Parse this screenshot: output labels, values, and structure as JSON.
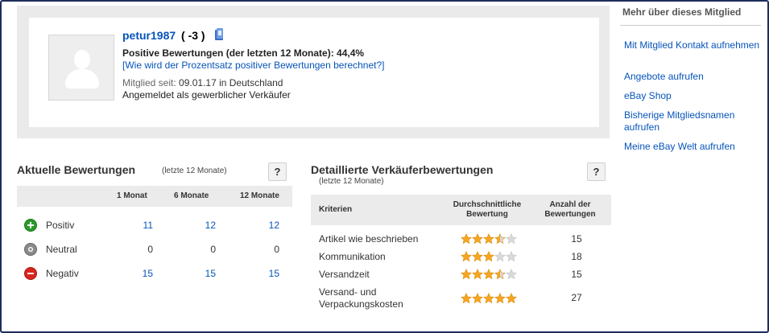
{
  "profile": {
    "username": "petur1987",
    "score": "( -3 )",
    "positive_line": "Positive Bewertungen (der letzten 12 Monate): 44,4%",
    "positive_link": "[Wie wird der Prozentsatz positiver Bewertungen berechnet?]",
    "member_since_label": "Mitglied seit:",
    "member_since_value": "09.01.17 in Deutschland",
    "seller_type": "Angemeldet als gewerblicher Verkäufer",
    "badge_icon": "blue-badge-icon"
  },
  "sidebar": {
    "title": "Mehr über dieses Mitglied",
    "links": [
      "Mit Mitglied Kontakt aufnehmen",
      "Angebote aufrufen",
      "eBay Shop",
      "Bisherige Mitgliedsnamen aufrufen",
      "Meine eBay Welt aufrufen"
    ]
  },
  "feedback": {
    "title": "Aktuelle Bewertungen",
    "subtitle": "(letzte 12 Monate)",
    "help": "?",
    "columns": [
      "1 Monat",
      "6 Monate",
      "12 Monate"
    ],
    "rows": [
      {
        "label": "Positiv",
        "icon": "plus-circle-icon",
        "color": "#2a9a2a",
        "values": [
          "11",
          "12",
          "12"
        ]
      },
      {
        "label": "Neutral",
        "icon": "neutral-circle-icon",
        "color": "#8a8a8a",
        "values": [
          "0",
          "0",
          "0"
        ]
      },
      {
        "label": "Negativ",
        "icon": "minus-circle-icon",
        "color": "#d7261e",
        "values": [
          "15",
          "15",
          "15"
        ]
      }
    ]
  },
  "dsr": {
    "title": "Detaillierte Verkäuferbewertungen",
    "subtitle": "(letzte 12 Monate)",
    "help": "?",
    "col_criteria": "Kriterien",
    "col_avg_1": "Durchschnittliche",
    "col_avg_2": "Bewertung",
    "col_count_1": "Anzahl der",
    "col_count_2": "Bewertungen",
    "star_color": "#f5a623",
    "star_empty_color": "#d9d9d9",
    "rows": [
      {
        "label_1": "Artikel wie beschrieben",
        "label_2": "",
        "rating": 3.5,
        "count": "15"
      },
      {
        "label_1": "Kommunikation",
        "label_2": "",
        "rating": 3,
        "count": "18"
      },
      {
        "label_1": "Versandzeit",
        "label_2": "",
        "rating": 3.5,
        "count": "15"
      },
      {
        "label_1": "Versand- und",
        "label_2": "Verpackungskosten",
        "rating": 5,
        "count": "27"
      }
    ]
  }
}
